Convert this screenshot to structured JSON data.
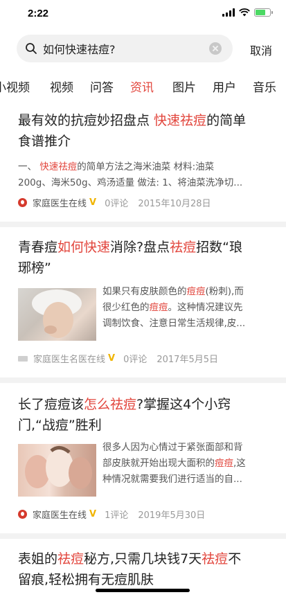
{
  "status": {
    "time": "2:22",
    "battery_level": 0.7
  },
  "search": {
    "query": "如何快速祛痘?",
    "cancel_label": "取消"
  },
  "tabs": [
    {
      "label": "小视频",
      "active": false
    },
    {
      "label": "视频",
      "active": false
    },
    {
      "label": "问答",
      "active": false
    },
    {
      "label": "资讯",
      "active": true
    },
    {
      "label": "图片",
      "active": false
    },
    {
      "label": "用户",
      "active": false
    },
    {
      "label": "音乐",
      "active": false
    }
  ],
  "articles": [
    {
      "title_line1_pre": "最有效的抗痘妙招盘点 ",
      "title_line1_hl": "快速祛痘",
      "title_line1_post": "的简单",
      "title_line2": "食谱推介",
      "desc_line1_pre": "一、 ",
      "desc_line1_hl": "快速祛痘",
      "desc_line1_post": "的简单方法之海米油菜 材料:油菜",
      "desc_line2": "200g、海米50g、鸡汤适量 做法: 1、将油菜洗净切...",
      "source": "家庭医生在线",
      "verified": "V",
      "comments": "0评论",
      "date": "2015年10月28日"
    },
    {
      "title_line1_pre": "青春痘",
      "title_line1_hl": "如何快速",
      "title_line1_mid": "消除?盘点",
      "title_line1_hl2": "祛痘",
      "title_line1_post": "招数“琅",
      "title_line2": "琊榜”",
      "desc_line1_pre": "如果只有皮肤颜色的",
      "desc_line1_hl": "痘痘",
      "desc_line1_post": "(粉刺),而",
      "desc_line2_pre": "很少红色的",
      "desc_line2_hl": "痘痘",
      "desc_line2_post": "。这种情况建议先",
      "desc_line3": "调制饮食、注意日常生活规律,皮...",
      "source": "家庭医生名医在线",
      "verified": "V",
      "comments": "0评论",
      "date": "2017年5月5日"
    },
    {
      "title_line1_pre": "长了痘痘该",
      "title_line1_hl": "怎么祛痘",
      "title_line1_post": "?掌握这4个小窍",
      "title_line2": "门,“战痘”胜利",
      "desc_line1": "很多人因为心情过于紧张面部和背",
      "desc_line2_pre": "部皮肤就开始出现大面积的",
      "desc_line2_hl": "痘痘",
      "desc_line2_post": ",这",
      "desc_line3": "种情况就需要我们进行适当的自...",
      "source": "家庭医生在线",
      "verified": "V",
      "comments": "1评论",
      "date": "2019年5月30日"
    },
    {
      "title_line1_pre": "表姐的",
      "title_line1_hl": "祛痘",
      "title_line1_mid": "秘方,只需几块钱7天",
      "title_line1_hl2": "祛痘",
      "title_line1_post": "不",
      "title_line2": "留痕,轻松拥有无痘肌肤"
    }
  ]
}
